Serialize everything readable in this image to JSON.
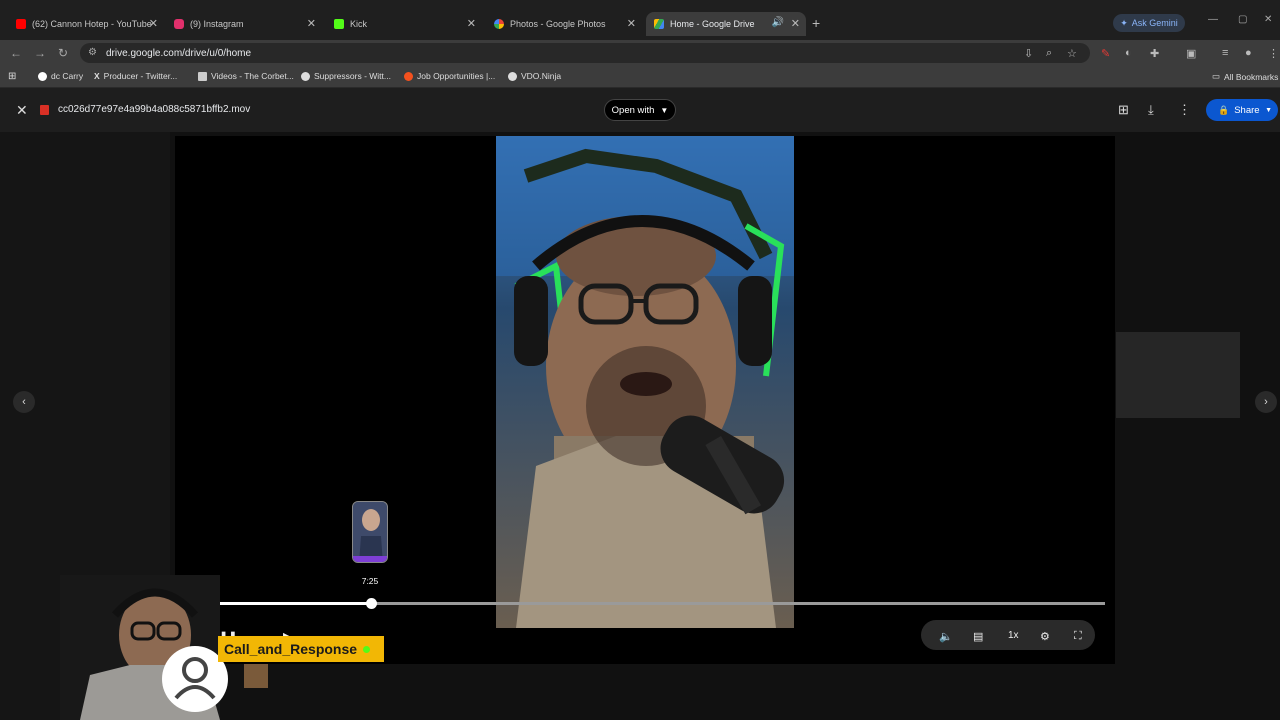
{
  "browser": {
    "tabs": [
      {
        "title": "(62) Cannon Hotep - YouTube",
        "favicon_color": "#ff0000"
      },
      {
        "title": "(9) Instagram",
        "favicon_color": "#e1306c"
      },
      {
        "title": "Kick",
        "favicon_color": "#53fc18"
      },
      {
        "title": "Photos - Google Photos",
        "favicon_color": "#fbbc04"
      },
      {
        "title": "Home - Google Drive",
        "favicon_color": "#34a853"
      }
    ],
    "new_tab": "+",
    "ask_gemini": "Ask Gemini",
    "url": "drive.google.com/drive/u/0/home",
    "bookmarks": [
      {
        "label": "dc Carry",
        "color": "#ffffff"
      },
      {
        "label": "Producer - Twitter...",
        "color": "#ffffff"
      },
      {
        "label": "Videos - The Corbet...",
        "color": "#ffffff"
      },
      {
        "label": "Suppressors - Witt...",
        "color": "#ffffff"
      },
      {
        "label": "Job Opportunities |...",
        "color": "#f4511e"
      },
      {
        "label": "VDO.Ninja",
        "color": "#ffffff"
      }
    ],
    "all_bookmarks": "All Bookmarks"
  },
  "viewer": {
    "filename": "cc026d77e97e4a99b4a088c5871bffb2.mov",
    "open_with": "Open with",
    "share": "Share"
  },
  "player": {
    "hover_time": "7:25",
    "progress": 0.2,
    "speed": "1x"
  },
  "overlay": {
    "badge": "Call_and_Response"
  },
  "colors": {
    "accent": "#0b57d0",
    "badge": "#f2b705"
  }
}
